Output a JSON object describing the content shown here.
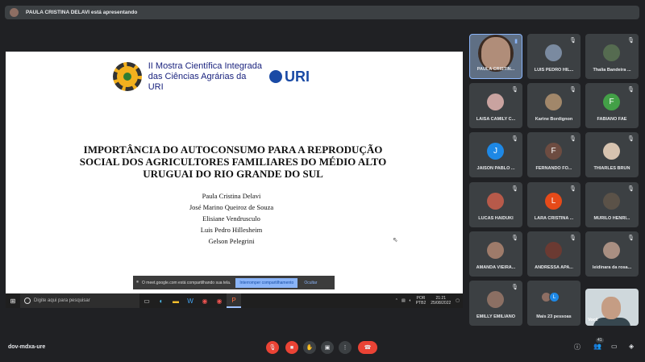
{
  "presenter_bar": {
    "text": "PAULA CRISTINA DELAVI está apresentando"
  },
  "slide": {
    "logo_text_line1": "II Mostra Científica Integrada",
    "logo_text_line2": "das Ciências Agrárias da URI",
    "logo_uri": "URI",
    "title_lines": [
      "IMPORTÂNCIA DO AUTOCONSUMO PARA A REPRODUÇÃO",
      "SOCIAL DOS AGRICULTORES FAMILIARES DO MÉDIO ALTO",
      "URUGUAI DO RIO GRANDE DO SUL"
    ],
    "authors": [
      "Paula Cristina Delavi",
      "José Marino Queiroz de Souza",
      "Elisiane Vendrusculo",
      "Luis Pedro Hillesheim",
      "Gelson Pelegrini"
    ]
  },
  "share_notice": {
    "text": "O meet.google.com está compartilhando sua tela.",
    "stop_label": "Interromper compartilhamento",
    "hide_label": "Ocultar"
  },
  "taskbar": {
    "search_placeholder": "Digite aqui para pesquisar",
    "lang_top": "POR",
    "lang_bottom": "PTB2",
    "time": "21:21",
    "date": "25/08/2022"
  },
  "participants": [
    {
      "name": "PAULA CRISTIN...",
      "type": "video-presenter"
    },
    {
      "name": "LUIS PEDRO HIL...",
      "type": "photo"
    },
    {
      "name": "Thalia Bandeira ...",
      "type": "photo"
    },
    {
      "name": "LAISA CAMILY C...",
      "type": "photo"
    },
    {
      "name": "Karine Bordignon",
      "type": "photo"
    },
    {
      "name": "FABIANO FAE",
      "type": "letter",
      "letter": "F",
      "color": "#43a047"
    },
    {
      "name": "JAISON PABLO ...",
      "type": "letter",
      "letter": "J",
      "color": "#1e88e5"
    },
    {
      "name": "FERNANDO FO...",
      "type": "letter",
      "letter": "F",
      "color": "#6d4c41"
    },
    {
      "name": "THIARLES BRUN",
      "type": "photo"
    },
    {
      "name": "LUCAS HAIDUKI",
      "type": "photo"
    },
    {
      "name": "LARA CRISTINA ...",
      "type": "letter",
      "letter": "L",
      "color": "#e64a19"
    },
    {
      "name": "MURILO HENRI...",
      "type": "photo"
    },
    {
      "name": "AMANDA VIEIRA...",
      "type": "photo"
    },
    {
      "name": "ANDRESSA APA...",
      "type": "photo"
    },
    {
      "name": "leidinara da rosa...",
      "type": "photo"
    },
    {
      "name": "EMILLY EMILIANO",
      "type": "photo"
    },
    {
      "name": "Mais 23 pessoas",
      "type": "more"
    },
    {
      "name": "Você",
      "type": "self"
    }
  ],
  "bottom": {
    "meeting_code": "dov-mdxa-ure",
    "participant_count": "41"
  }
}
